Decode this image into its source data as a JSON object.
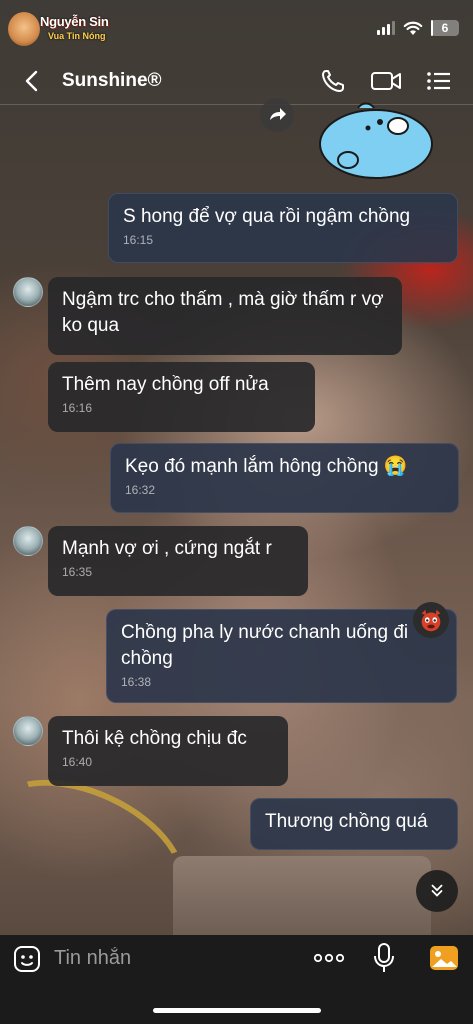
{
  "status_bar": {
    "logo_name": "Nguyễn Sin",
    "logo_subtitle": "Vua Tin Nóng",
    "battery": "6",
    "battery_level": 0.06
  },
  "header": {
    "contact_name": "Sunshine®",
    "back_icon": "chevron-left-icon",
    "call_icon": "phone-icon",
    "video_icon": "video-camera-icon",
    "menu_icon": "list-menu-icon"
  },
  "messages": [
    {
      "direction": "out",
      "text": "S hong để vợ qua rồi ngậm chồng",
      "time": "16:15"
    },
    {
      "direction": "in",
      "text": "Ngậm trc cho thấm , mà giờ thấm r vợ ko qua",
      "time": ""
    },
    {
      "direction": "in",
      "text": "Thêm nay chồng off nửa",
      "time": "16:16"
    },
    {
      "direction": "out",
      "text": "Kẹo đó mạnh lắm hông chồng 😭",
      "time": "16:32"
    },
    {
      "direction": "in",
      "text": "Mạnh vợ ơi , cứng ngắt r",
      "time": "16:35"
    },
    {
      "direction": "out",
      "text": "Chồng pha ly nước chanh uống đi chồng",
      "time": "16:38",
      "reaction": "devil-emoji"
    },
    {
      "direction": "in",
      "text": "Thôi kệ chồng chịu đc",
      "time": "16:40"
    },
    {
      "direction": "out",
      "text": "Thương chồng quá",
      "time": ""
    }
  ],
  "input_bar": {
    "placeholder": "Tin nhắn",
    "value": ""
  },
  "colors": {
    "incoming_bubble": "#28282a",
    "outgoing_bubble": "#2c364a",
    "input_bar_bg": "#1b1b1b",
    "photo_button": "#f0a020"
  }
}
